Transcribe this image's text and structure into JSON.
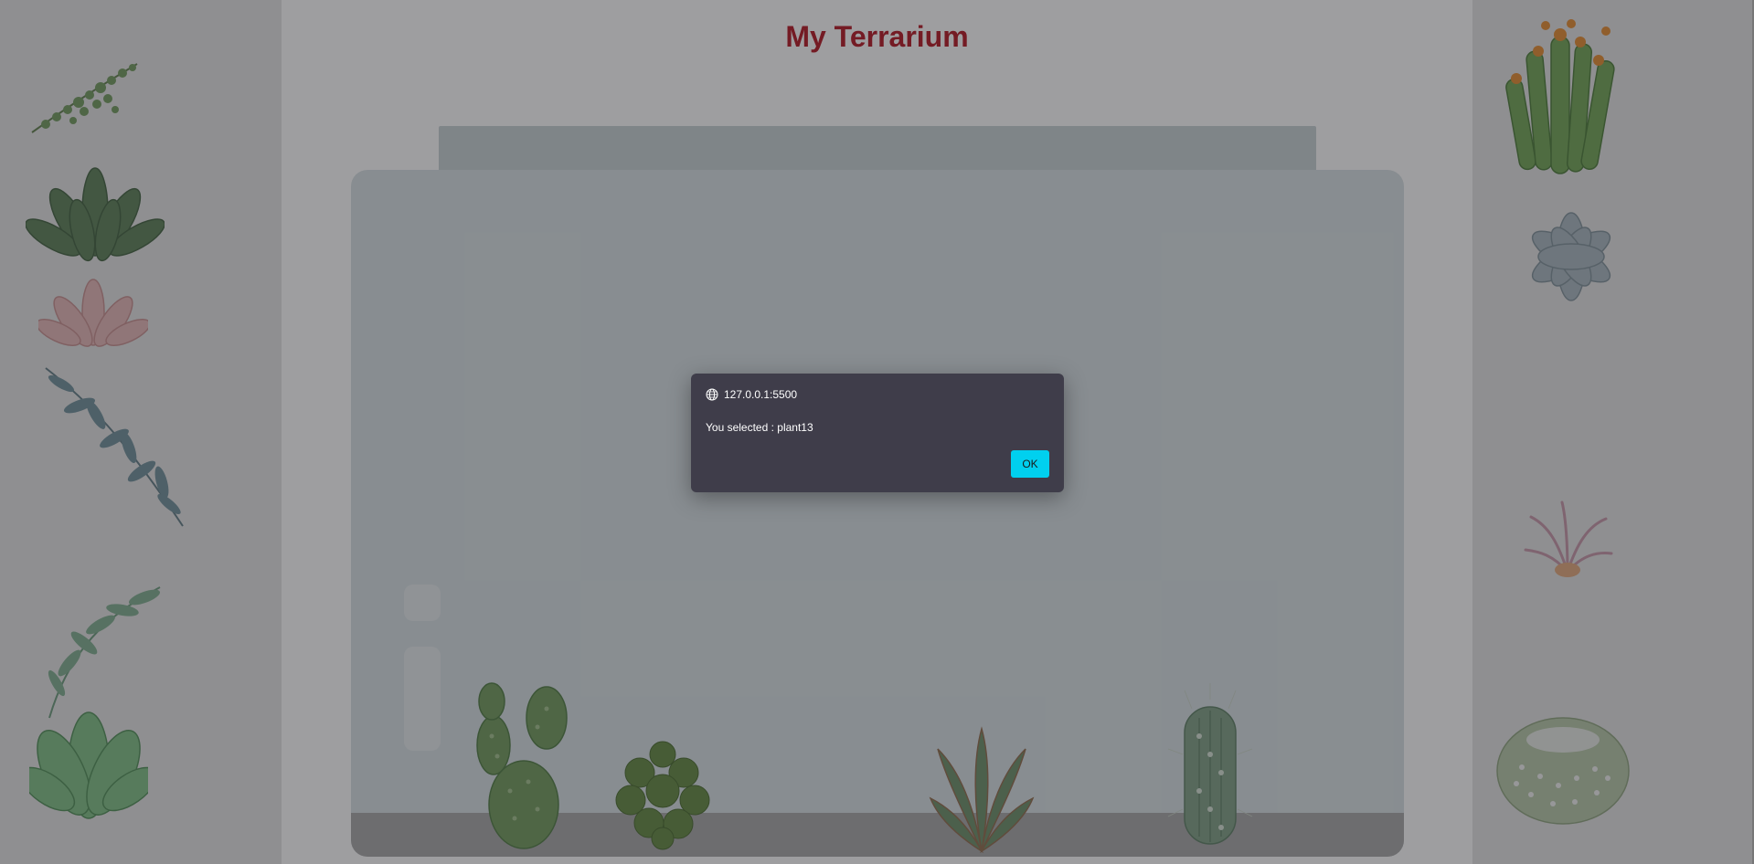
{
  "page": {
    "title": "My Terrarium"
  },
  "dialog": {
    "origin": "127.0.0.1:5500",
    "message": "You selected : plant13",
    "ok_label": "OK"
  },
  "colors": {
    "title": "#b3121e",
    "dialog_bg": "#3f3d4a",
    "ok_button": "#00d0ef",
    "side_panel": "#e4e4e4",
    "jar": "#d8e1e4"
  },
  "plants": {
    "left": [
      "plant1",
      "plant2",
      "plant3",
      "plant4",
      "plant5",
      "plant6"
    ],
    "right": [
      "plant7",
      "plant8",
      "plant9",
      "plant10"
    ],
    "jar": [
      "plant11",
      "plant12",
      "plant13",
      "plant14"
    ]
  }
}
